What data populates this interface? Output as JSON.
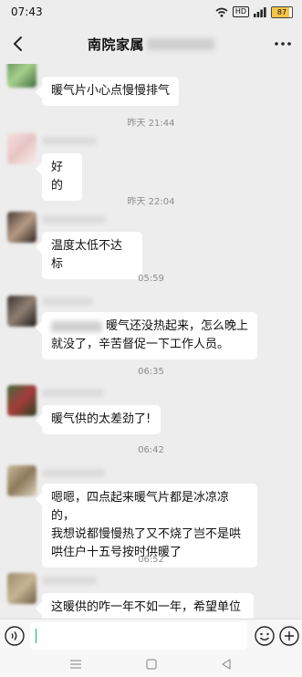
{
  "status_bar": {
    "time": "07:43",
    "hd": "HD",
    "battery": "87",
    "battery_level": 0.87
  },
  "header": {
    "title": "南院家属",
    "back_icon": "chevron-left-icon",
    "more_icon": "more-dots-icon"
  },
  "messages": [
    {
      "text": "暖气片小心点慢慢排气"
    },
    {
      "time": "昨天 21:44"
    },
    {
      "text": "好的"
    },
    {
      "time": "昨天 22:04"
    },
    {
      "text": "温度太低不达标"
    },
    {
      "time": "05:59"
    },
    {
      "text_line1": "暖气还没热起来，怎么晚上",
      "text_line2": "就没了，辛苦督促一下工作人员。"
    },
    {
      "time": "06:35"
    },
    {
      "text": "暖气供的太差劲了!"
    },
    {
      "time": "06:42"
    },
    {
      "text_line1": "嗯嗯，四点起来暖气片都是冰凉凉的，",
      "text_line2": "我想说都慢慢热了又不烧了岂不是哄",
      "text_line3": "哄住户十五号按时供暖了"
    },
    {
      "time": "06:52"
    },
    {
      "text": "这暖供的咋一年不如一年，希望单位"
    }
  ],
  "input_bar": {
    "placeholder": "",
    "voice_icon": "voice-icon",
    "emoji_icon": "emoji-icon",
    "plus_icon": "plus-icon"
  },
  "colors": {
    "background": "#ededed",
    "bubble": "#ffffff",
    "accent": "#07c160",
    "time_text": "#8c8c8c"
  }
}
